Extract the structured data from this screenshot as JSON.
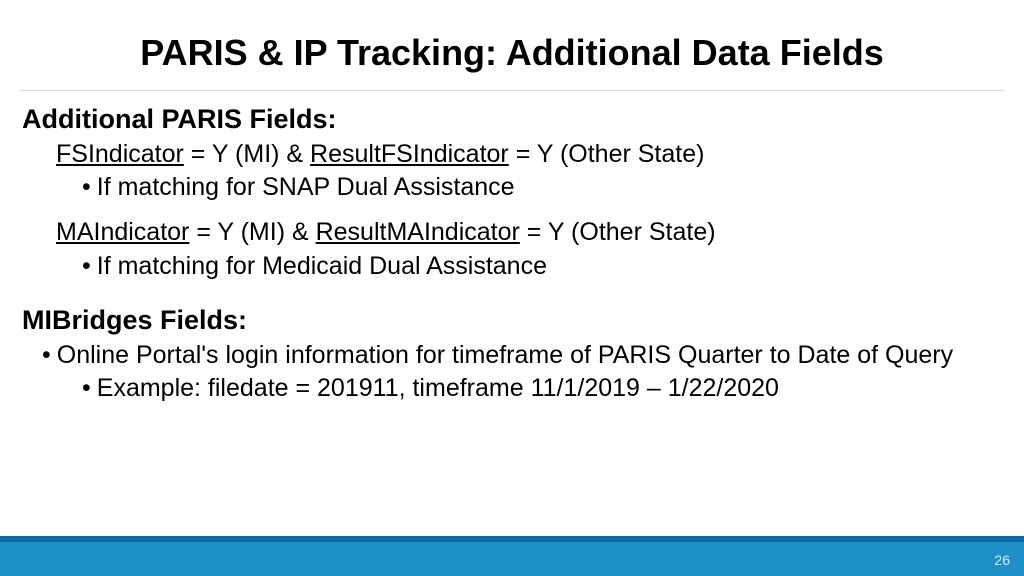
{
  "title": "PARIS & IP Tracking: Additional Data Fields",
  "sections": {
    "paris": {
      "heading": "Additional PARIS Fields:",
      "fs": {
        "ind1": "FSIndicator",
        "mid": " = Y (MI) & ",
        "ind2": "ResultFSIndicator",
        "tail": " = Y (Other State)",
        "sub": "If matching for SNAP Dual Assistance"
      },
      "ma": {
        "ind1": "MAIndicator",
        "mid": " = Y (MI) & ",
        "ind2": "ResultMAIndicator",
        "tail": " = Y (Other State)",
        "sub": "If matching for Medicaid Dual Assistance"
      }
    },
    "mibridges": {
      "heading": "MIBridges Fields:",
      "bullet": "Online Portal's login information for timeframe of PARIS Quarter to Date of Query",
      "example": "Example: filedate = 201911, timeframe 11/1/2019 – 1/22/2020"
    }
  },
  "page_number": "26"
}
